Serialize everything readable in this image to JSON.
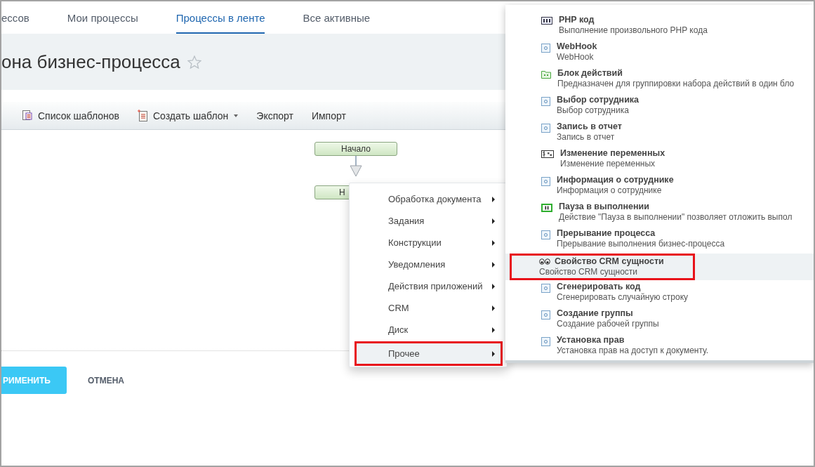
{
  "tabs": [
    {
      "label": "ессов",
      "selected": false
    },
    {
      "label": "Мои процессы",
      "selected": false
    },
    {
      "label": "Процессы в ленте",
      "selected": true
    },
    {
      "label": "Все активные",
      "selected": false
    }
  ],
  "page_title": "она бизнес-процесса",
  "toolbar": [
    {
      "label": "Список шаблонов",
      "kind": "list",
      "dropdown": false
    },
    {
      "label": "Создать шаблон",
      "kind": "new",
      "dropdown": true
    },
    {
      "label": "Экспорт",
      "kind": "plain",
      "dropdown": false
    },
    {
      "label": "Импорт",
      "kind": "plain",
      "dropdown": false
    }
  ],
  "diagram": {
    "nodes": [
      "Начало",
      "Н"
    ]
  },
  "context_menu": {
    "items": [
      {
        "label": "Обработка документа",
        "highlighted": false
      },
      {
        "label": "Задания",
        "highlighted": false
      },
      {
        "label": "Конструкции",
        "highlighted": false
      },
      {
        "label": "Уведомления",
        "highlighted": false
      },
      {
        "label": "Действия приложений",
        "highlighted": false
      },
      {
        "label": "CRM",
        "highlighted": false
      },
      {
        "label": "Диск",
        "highlighted": false
      },
      {
        "label": "Прочее",
        "highlighted": true
      }
    ]
  },
  "submenu": {
    "items": [
      {
        "kind": "php",
        "title": "PHP код",
        "description": "Выполнение произвольного PHP кода",
        "highlighted": false
      },
      {
        "kind": "activity",
        "title": "WebHook",
        "description": "WebHook",
        "highlighted": false
      },
      {
        "kind": "block",
        "title": "Блок действий",
        "description": "Предназначен для группировки набора действий в один бло",
        "highlighted": false
      },
      {
        "kind": "activity",
        "title": "Выбор сотрудника",
        "description": "Выбор сотрудника",
        "highlighted": false
      },
      {
        "kind": "activity",
        "title": "Запись в отчет",
        "description": "Запись в отчет",
        "highlighted": false
      },
      {
        "kind": "variables",
        "title": "Изменение переменных",
        "description": "Изменение переменных",
        "highlighted": false
      },
      {
        "kind": "activity",
        "title": "Информация о сотруднике",
        "description": "Информация о сотруднике",
        "highlighted": false
      },
      {
        "kind": "pause",
        "title": "Пауза в выполнении",
        "description": "Действие \"Пауза в выполнении\" позволяет отложить выпол",
        "highlighted": false
      },
      {
        "kind": "activity",
        "title": "Прерывание процесса",
        "description": "Прерывание выполнения бизнес-процесса",
        "highlighted": false
      },
      {
        "kind": "crm",
        "title": "Свойство CRM сущности",
        "description": "Свойство CRM сущности",
        "highlighted": true
      },
      {
        "kind": "activity",
        "title": "Сгенерировать код",
        "description": "Сгенерировать случайную строку",
        "highlighted": false
      },
      {
        "kind": "activity",
        "title": "Создание группы",
        "description": "Создание рабочей группы",
        "highlighted": false
      },
      {
        "kind": "activity",
        "title": "Установка прав",
        "description": "Установка прав на доступ к документу.",
        "highlighted": false
      }
    ]
  },
  "buttons": {
    "apply": "РИМЕНИТЬ",
    "cancel": "ОТМЕНА"
  }
}
